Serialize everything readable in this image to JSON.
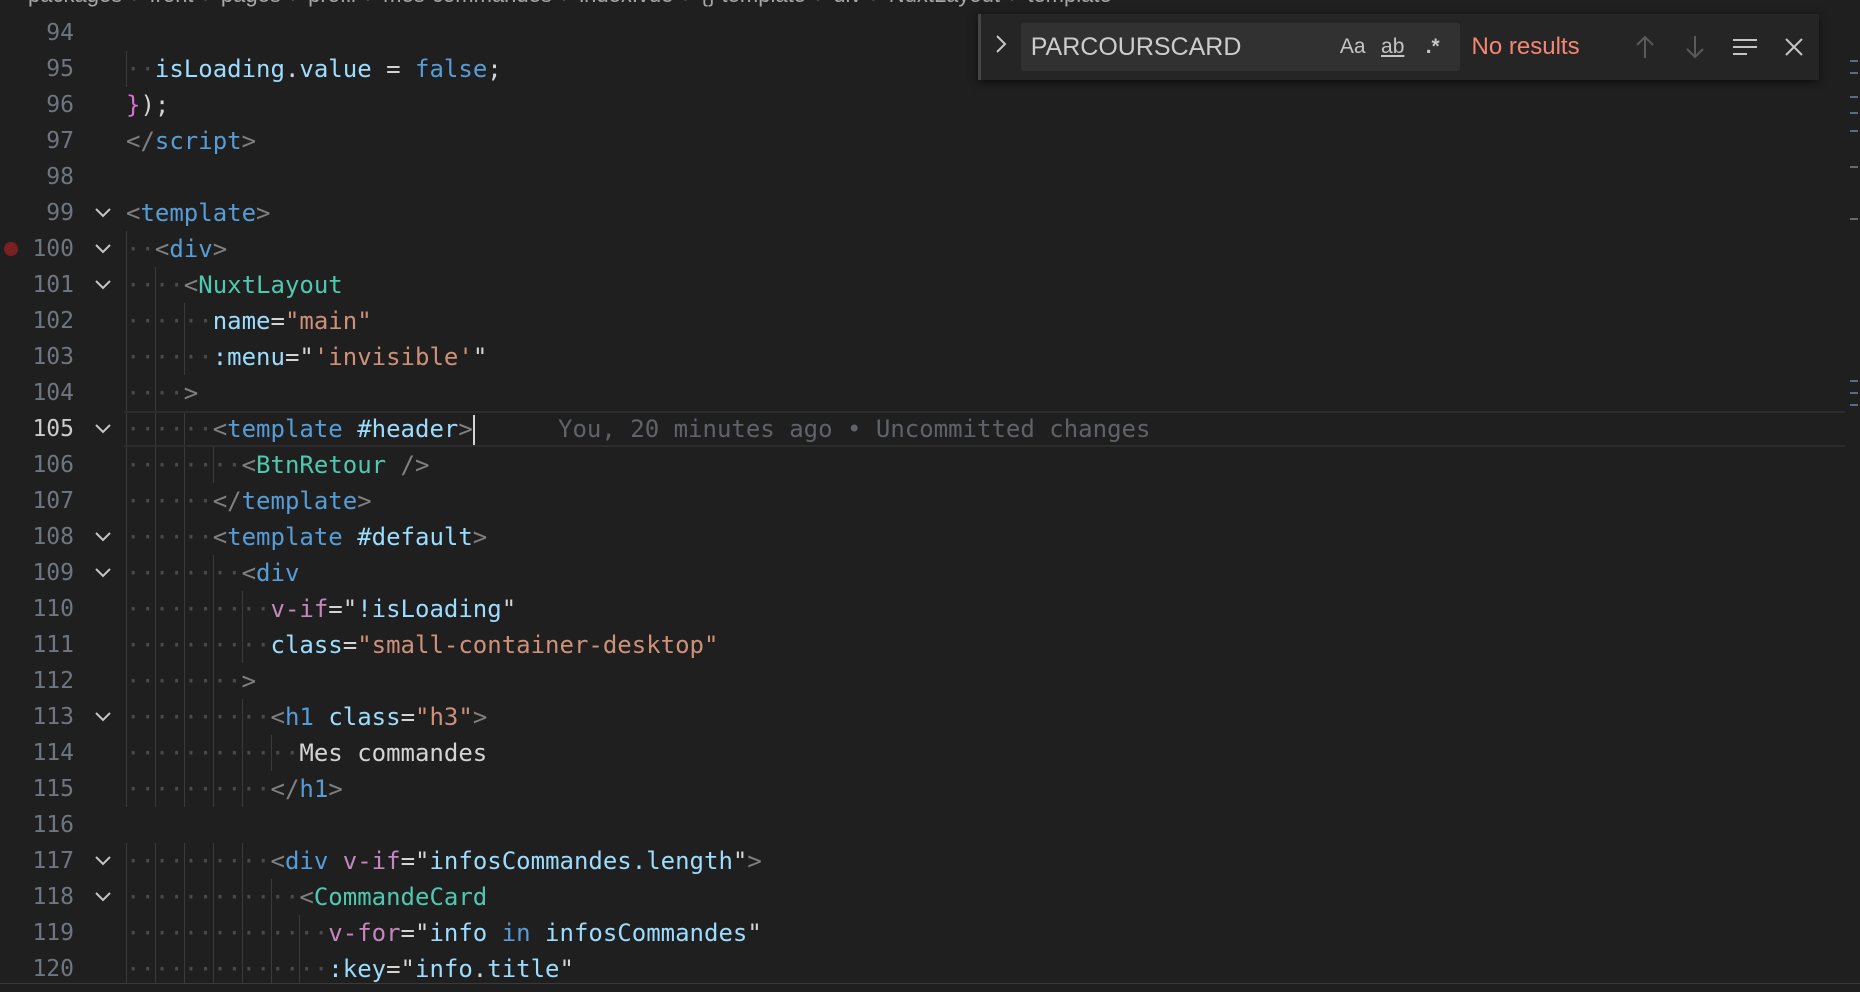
{
  "breadcrumb": [
    "packages",
    "front",
    "pages",
    "profil",
    "mes-commandes",
    "index.vue",
    "{} template",
    "div",
    "NuxtLayout",
    "template"
  ],
  "editor": {
    "lines": [
      {
        "n": "94",
        "fold": false,
        "indent": 0,
        "tokens": []
      },
      {
        "n": "95",
        "fold": false,
        "indent": 1,
        "tokens": [
          {
            "t": "isLoading",
            "c": "var"
          },
          {
            "t": ".",
            "c": "text"
          },
          {
            "t": "value",
            "c": "var"
          },
          {
            "t": " = ",
            "c": "text"
          },
          {
            "t": "false",
            "c": "kw"
          },
          {
            "t": ";",
            "c": "text"
          }
        ]
      },
      {
        "n": "96",
        "fold": false,
        "indent": 0,
        "tokens": [
          {
            "t": "}",
            "c": "brace"
          },
          {
            "t": ");",
            "c": "text"
          }
        ]
      },
      {
        "n": "97",
        "fold": false,
        "indent": 0,
        "tokens": [
          {
            "t": "</",
            "c": "punct"
          },
          {
            "t": "script",
            "c": "tag"
          },
          {
            "t": ">",
            "c": "punct"
          }
        ]
      },
      {
        "n": "98",
        "fold": false,
        "indent": 0,
        "tokens": []
      },
      {
        "n": "99",
        "fold": true,
        "indent": 0,
        "tokens": [
          {
            "t": "<",
            "c": "punct"
          },
          {
            "t": "template",
            "c": "tag"
          },
          {
            "t": ">",
            "c": "punct"
          }
        ]
      },
      {
        "n": "100",
        "fold": true,
        "breakpoint": true,
        "indent": 1,
        "tokens": [
          {
            "t": "<",
            "c": "punct"
          },
          {
            "t": "div",
            "c": "tag"
          },
          {
            "t": ">",
            "c": "punct"
          }
        ]
      },
      {
        "n": "101",
        "fold": true,
        "indent": 2,
        "tokens": [
          {
            "t": "<",
            "c": "punct"
          },
          {
            "t": "NuxtLayout",
            "c": "comp"
          }
        ]
      },
      {
        "n": "102",
        "fold": false,
        "indent": 3,
        "tokens": [
          {
            "t": "name",
            "c": "attr"
          },
          {
            "t": "=",
            "c": "text"
          },
          {
            "t": "\"main\"",
            "c": "str"
          }
        ]
      },
      {
        "n": "103",
        "fold": false,
        "indent": 3,
        "tokens": [
          {
            "t": ":menu",
            "c": "attr"
          },
          {
            "t": "=",
            "c": "text"
          },
          {
            "t": "\"",
            "c": "text"
          },
          {
            "t": "'invisible'",
            "c": "str"
          },
          {
            "t": "\"",
            "c": "text"
          }
        ]
      },
      {
        "n": "104",
        "fold": false,
        "indent": 2,
        "tokens": [
          {
            "t": ">",
            "c": "punct"
          }
        ]
      },
      {
        "n": "105",
        "fold": true,
        "indent": 3,
        "current": true,
        "tokens": [
          {
            "t": "<",
            "c": "punct"
          },
          {
            "t": "template",
            "c": "tag"
          },
          {
            "t": " ",
            "c": "text"
          },
          {
            "t": "#header",
            "c": "attr"
          },
          {
            "t": ">",
            "c": "punct"
          }
        ]
      },
      {
        "n": "106",
        "fold": false,
        "indent": 4,
        "tokens": [
          {
            "t": "<",
            "c": "punct"
          },
          {
            "t": "BtnRetour",
            "c": "comp"
          },
          {
            "t": " />",
            "c": "punct"
          }
        ]
      },
      {
        "n": "107",
        "fold": false,
        "indent": 3,
        "tokens": [
          {
            "t": "</",
            "c": "punct"
          },
          {
            "t": "template",
            "c": "tag"
          },
          {
            "t": ">",
            "c": "punct"
          }
        ]
      },
      {
        "n": "108",
        "fold": true,
        "indent": 3,
        "tokens": [
          {
            "t": "<",
            "c": "punct"
          },
          {
            "t": "template",
            "c": "tag"
          },
          {
            "t": " ",
            "c": "text"
          },
          {
            "t": "#default",
            "c": "attr"
          },
          {
            "t": ">",
            "c": "punct"
          }
        ]
      },
      {
        "n": "109",
        "fold": true,
        "indent": 4,
        "tokens": [
          {
            "t": "<",
            "c": "punct"
          },
          {
            "t": "div",
            "c": "tag"
          }
        ]
      },
      {
        "n": "110",
        "fold": false,
        "indent": 5,
        "tokens": [
          {
            "t": "v-if",
            "c": "dir"
          },
          {
            "t": "=",
            "c": "text"
          },
          {
            "t": "\"",
            "c": "text"
          },
          {
            "t": "!isLoading",
            "c": "var"
          },
          {
            "t": "\"",
            "c": "text"
          }
        ]
      },
      {
        "n": "111",
        "fold": false,
        "indent": 5,
        "tokens": [
          {
            "t": "class",
            "c": "attr"
          },
          {
            "t": "=",
            "c": "text"
          },
          {
            "t": "\"small-container-desktop\"",
            "c": "str"
          }
        ]
      },
      {
        "n": "112",
        "fold": false,
        "indent": 4,
        "tokens": [
          {
            "t": ">",
            "c": "punct"
          }
        ]
      },
      {
        "n": "113",
        "fold": true,
        "indent": 5,
        "tokens": [
          {
            "t": "<",
            "c": "punct"
          },
          {
            "t": "h1",
            "c": "tag"
          },
          {
            "t": " ",
            "c": "text"
          },
          {
            "t": "class",
            "c": "attr"
          },
          {
            "t": "=",
            "c": "text"
          },
          {
            "t": "\"h3\"",
            "c": "str"
          },
          {
            "t": ">",
            "c": "punct"
          }
        ]
      },
      {
        "n": "114",
        "fold": false,
        "indent": 6,
        "tokens": [
          {
            "t": "Mes commandes",
            "c": "text"
          }
        ]
      },
      {
        "n": "115",
        "fold": false,
        "indent": 5,
        "tokens": [
          {
            "t": "</",
            "c": "punct"
          },
          {
            "t": "h1",
            "c": "tag"
          },
          {
            "t": ">",
            "c": "punct"
          }
        ]
      },
      {
        "n": "116",
        "fold": false,
        "indent": 0,
        "tokens": []
      },
      {
        "n": "117",
        "fold": true,
        "indent": 5,
        "tokens": [
          {
            "t": "<",
            "c": "punct"
          },
          {
            "t": "div",
            "c": "tag"
          },
          {
            "t": " ",
            "c": "text"
          },
          {
            "t": "v-if",
            "c": "dir"
          },
          {
            "t": "=",
            "c": "text"
          },
          {
            "t": "\"",
            "c": "text"
          },
          {
            "t": "infosCommandes.length",
            "c": "var"
          },
          {
            "t": "\"",
            "c": "text"
          },
          {
            "t": ">",
            "c": "punct"
          }
        ]
      },
      {
        "n": "118",
        "fold": true,
        "indent": 6,
        "tokens": [
          {
            "t": "<",
            "c": "punct"
          },
          {
            "t": "CommandeCard",
            "c": "comp"
          }
        ]
      },
      {
        "n": "119",
        "fold": false,
        "indent": 7,
        "tokens": [
          {
            "t": "v-for",
            "c": "dir"
          },
          {
            "t": "=",
            "c": "text"
          },
          {
            "t": "\"",
            "c": "text"
          },
          {
            "t": "info",
            "c": "var"
          },
          {
            "t": " in ",
            "c": "kw"
          },
          {
            "t": "infosCommandes",
            "c": "var"
          },
          {
            "t": "\"",
            "c": "text"
          }
        ]
      },
      {
        "n": "120",
        "fold": false,
        "indent": 7,
        "tokens": [
          {
            "t": ":key",
            "c": "attr"
          },
          {
            "t": "=",
            "c": "text"
          },
          {
            "t": "\"",
            "c": "text"
          },
          {
            "t": "info",
            "c": "var"
          },
          {
            "t": ".",
            "c": "text"
          },
          {
            "t": "title",
            "c": "var"
          },
          {
            "t": "\"",
            "c": "text"
          }
        ]
      }
    ],
    "blame": "You, 20 minutes ago • Uncommitted changes"
  },
  "find": {
    "query": "PARCOURSCARD",
    "match_case_label": "Aa",
    "whole_word_label": "ab",
    "regex_label": ".*",
    "status": "No results"
  }
}
